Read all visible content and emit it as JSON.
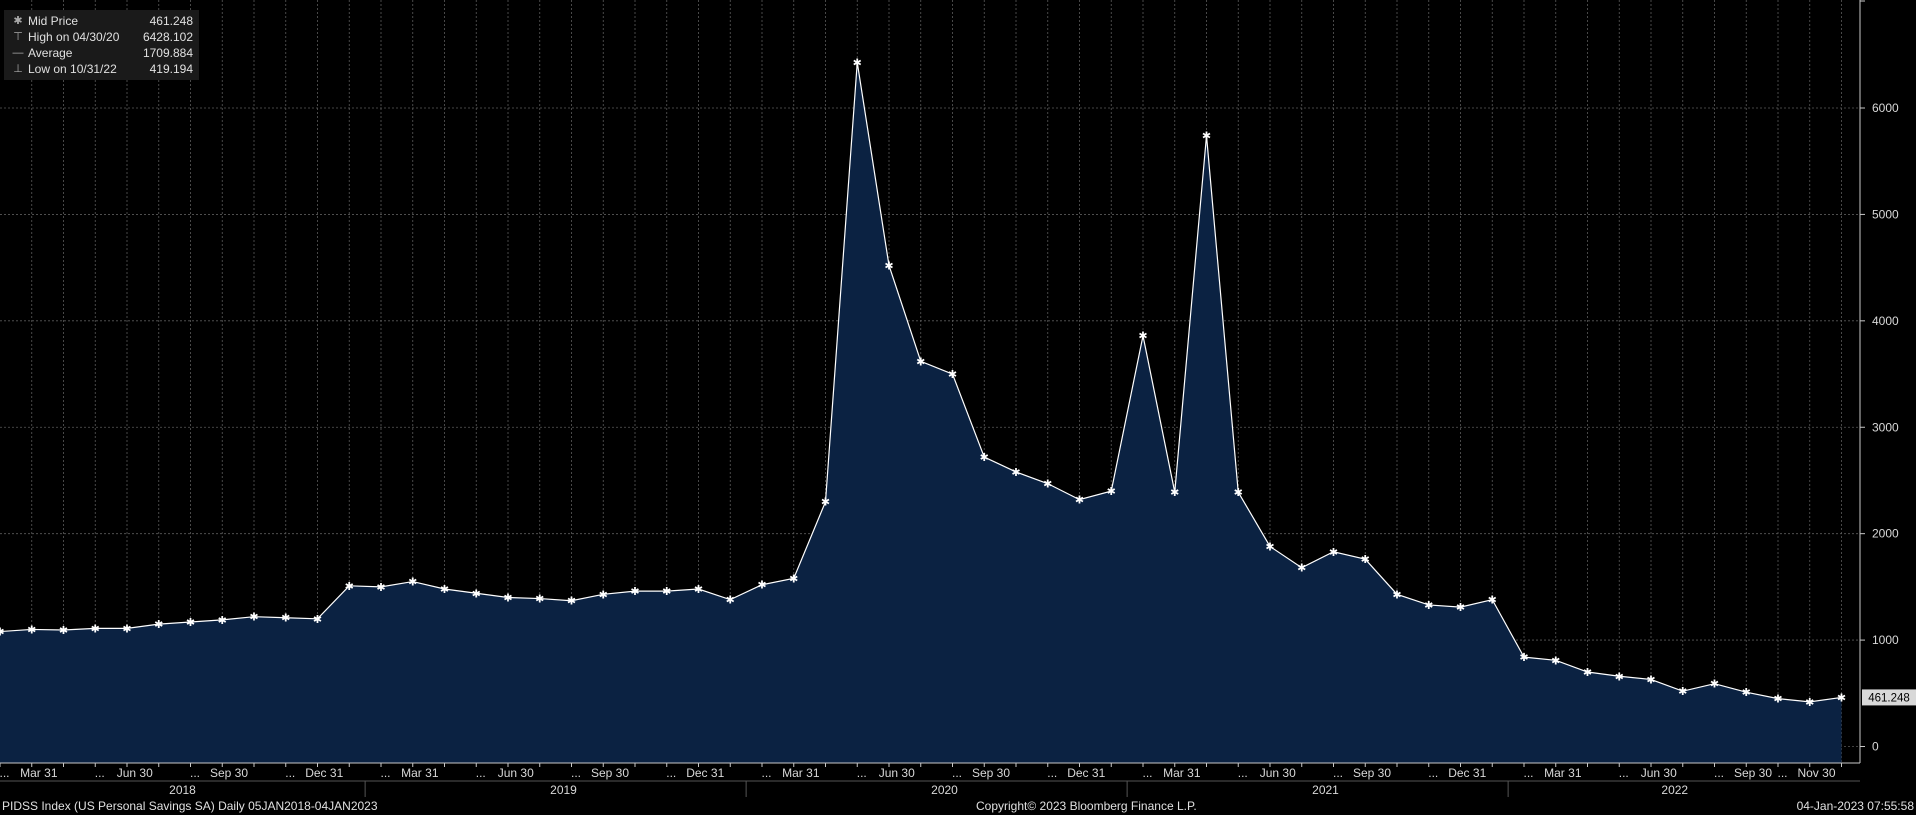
{
  "chart_data": {
    "type": "area",
    "ticker": "PIDSS Index (US Personal Savings SA)",
    "frequency": "Daily",
    "date_range": "05JAN2018-04JAN2023",
    "series": [
      {
        "name": "Mid Price",
        "x": [
          "Jan 31 2018",
          "Feb 28 2018",
          "Mar 31 2018",
          "Apr 30 2018",
          "May 31 2018",
          "Jun 30 2018",
          "Jul 31 2018",
          "Aug 31 2018",
          "Sep 30 2018",
          "Oct 31 2018",
          "Nov 30 2018",
          "Dec 31 2018",
          "Jan 31 2019",
          "Feb 28 2019",
          "Mar 31 2019",
          "Apr 30 2019",
          "May 31 2019",
          "Jun 30 2019",
          "Jul 31 2019",
          "Aug 31 2019",
          "Sep 30 2019",
          "Oct 31 2019",
          "Nov 30 2019",
          "Dec 31 2019",
          "Jan 31 2020",
          "Feb 29 2020",
          "Mar 31 2020",
          "Apr 30 2020",
          "May 31 2020",
          "Jun 30 2020",
          "Jul 31 2020",
          "Aug 31 2020",
          "Sep 30 2020",
          "Oct 31 2020",
          "Nov 30 2020",
          "Dec 31 2020",
          "Jan 31 2021",
          "Feb 28 2021",
          "Mar 31 2021",
          "Apr 30 2021",
          "May 31 2021",
          "Jun 30 2021",
          "Jul 31 2021",
          "Aug 31 2021",
          "Sep 30 2021",
          "Oct 31 2021",
          "Nov 30 2021",
          "Dec 31 2021",
          "Jan 31 2022",
          "Feb 28 2022",
          "Mar 31 2022",
          "Apr 30 2022",
          "May 31 2022",
          "Jun 30 2022",
          "Jul 31 2022",
          "Aug 31 2022",
          "Sep 30 2022",
          "Oct 31 2022",
          "Nov 30 2022"
        ],
        "values": [
          1080,
          1100,
          1095,
          1110,
          1110,
          1150,
          1170,
          1190,
          1220,
          1210,
          1200,
          1510,
          1500,
          1550,
          1480,
          1440,
          1400,
          1390,
          1370,
          1430,
          1460,
          1460,
          1480,
          1380,
          1520,
          1580,
          2300,
          6428.102,
          4520,
          3620,
          3500,
          2720,
          2580,
          2470,
          2320,
          2400,
          3860,
          2390,
          5740,
          2390,
          1880,
          1680,
          1830,
          1760,
          1430,
          1330,
          1310,
          1380,
          840,
          810,
          700,
          660,
          630,
          520,
          590,
          510,
          450,
          419.194,
          461.248
        ]
      }
    ],
    "legend": [
      {
        "icon": "asterisk-icon",
        "label": "Mid Price",
        "value": "461.248"
      },
      {
        "icon": "high-marker-icon",
        "label": "High on 04/30/20",
        "value": "6428.102"
      },
      {
        "icon": "average-line-icon",
        "label": "Average",
        "value": "1709.884"
      },
      {
        "icon": "low-marker-icon",
        "label": "Low on 10/31/22",
        "value": "419.194"
      }
    ],
    "y_ticks": [
      "0",
      "1000",
      "2000",
      "3000",
      "4000",
      "5000",
      "6000"
    ],
    "ylim": [
      -150,
      7000
    ],
    "x_tick_labels": [
      "Mar 31",
      "Jun 30",
      "Sep 30",
      "Dec 31",
      "Mar 31",
      "Jun 30",
      "Sep 30",
      "Dec 31",
      "Mar 31",
      "Jun 30",
      "Sep 30",
      "Dec 31",
      "Mar 31",
      "Jun 30",
      "Sep 30",
      "Dec 31",
      "Mar 31",
      "Jun 30",
      "Sep 30",
      "Nov 30"
    ],
    "year_labels": [
      "2018",
      "2019",
      "2020",
      "2021",
      "2022"
    ],
    "last_value_label": "461.248",
    "grid": true,
    "legend_position": "top-left",
    "colors": {
      "background": "#000000",
      "area_fill": "#0b2242",
      "line": "#ffffff",
      "grid": "#5a5a5a",
      "text": "#d8d8d8"
    }
  },
  "footer": {
    "left": "PIDSS Index (US Personal Savings SA)  Daily 05JAN2018-04JAN2023",
    "center": "Copyright© 2023 Bloomberg Finance L.P.",
    "right": "04-Jan-2023 07:55:58"
  }
}
